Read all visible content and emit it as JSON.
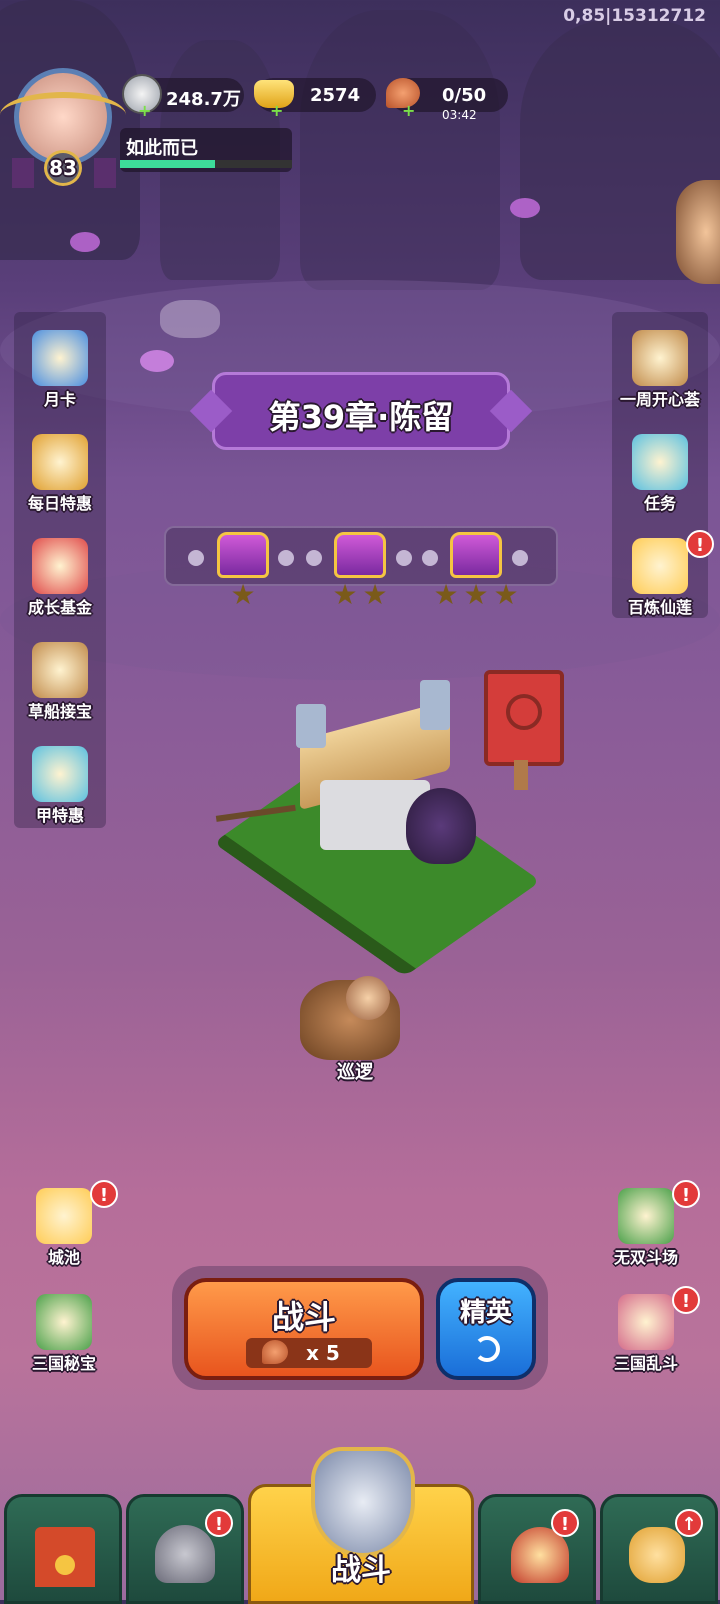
{
  "debug_info": "0,85|15312712",
  "player": {
    "level": "83",
    "name": "如此而已",
    "xp_fraction": 0.55
  },
  "resources": {
    "silver": "248.7万",
    "gold": "2574",
    "stamina": "0/50",
    "stamina_timer": "03:42"
  },
  "chapter": {
    "title": "第39章·陈留"
  },
  "progress": {
    "chests": 3,
    "stars": [
      1,
      2,
      3
    ]
  },
  "left_menu": [
    {
      "label": "月卡",
      "icon": "month-card-icon"
    },
    {
      "label": "每日特惠",
      "icon": "daily-deal-icon"
    },
    {
      "label": "成长基金",
      "icon": "growth-fund-icon"
    },
    {
      "label": "草船接宝",
      "icon": "straw-boat-icon"
    },
    {
      "label": "甲特惠",
      "icon": "armor-deal-icon"
    }
  ],
  "right_menu": [
    {
      "label": "一周开心荟",
      "icon": "weekly-event-icon"
    },
    {
      "label": "任务",
      "icon": "quest-scroll-icon"
    },
    {
      "label": "百炼仙莲",
      "icon": "lotus-event-icon",
      "alert": "!"
    }
  ],
  "stage": {
    "patrol_label": "巡逻"
  },
  "bottom_left": [
    {
      "label": "城池",
      "icon": "city-icon",
      "alert": "!"
    },
    {
      "label": "三国秘宝",
      "icon": "secret-treasure-icon"
    }
  ],
  "bottom_right": [
    {
      "label": "无双斗场",
      "icon": "arena-icon",
      "alert": "!"
    },
    {
      "label": "三国乱斗",
      "icon": "brawl-icon",
      "alert": "!"
    }
  ],
  "battle": {
    "label": "战斗",
    "cost": "x 5",
    "elite_label": "精英"
  },
  "nav": {
    "center_label": "战斗",
    "alert": "!",
    "up_arrow": "↑"
  },
  "colors": {
    "battle_orange": "#f06a2a",
    "elite_blue": "#2a8ee8",
    "nav_green": "#2f6b55",
    "alert_red": "#e23a3a"
  }
}
